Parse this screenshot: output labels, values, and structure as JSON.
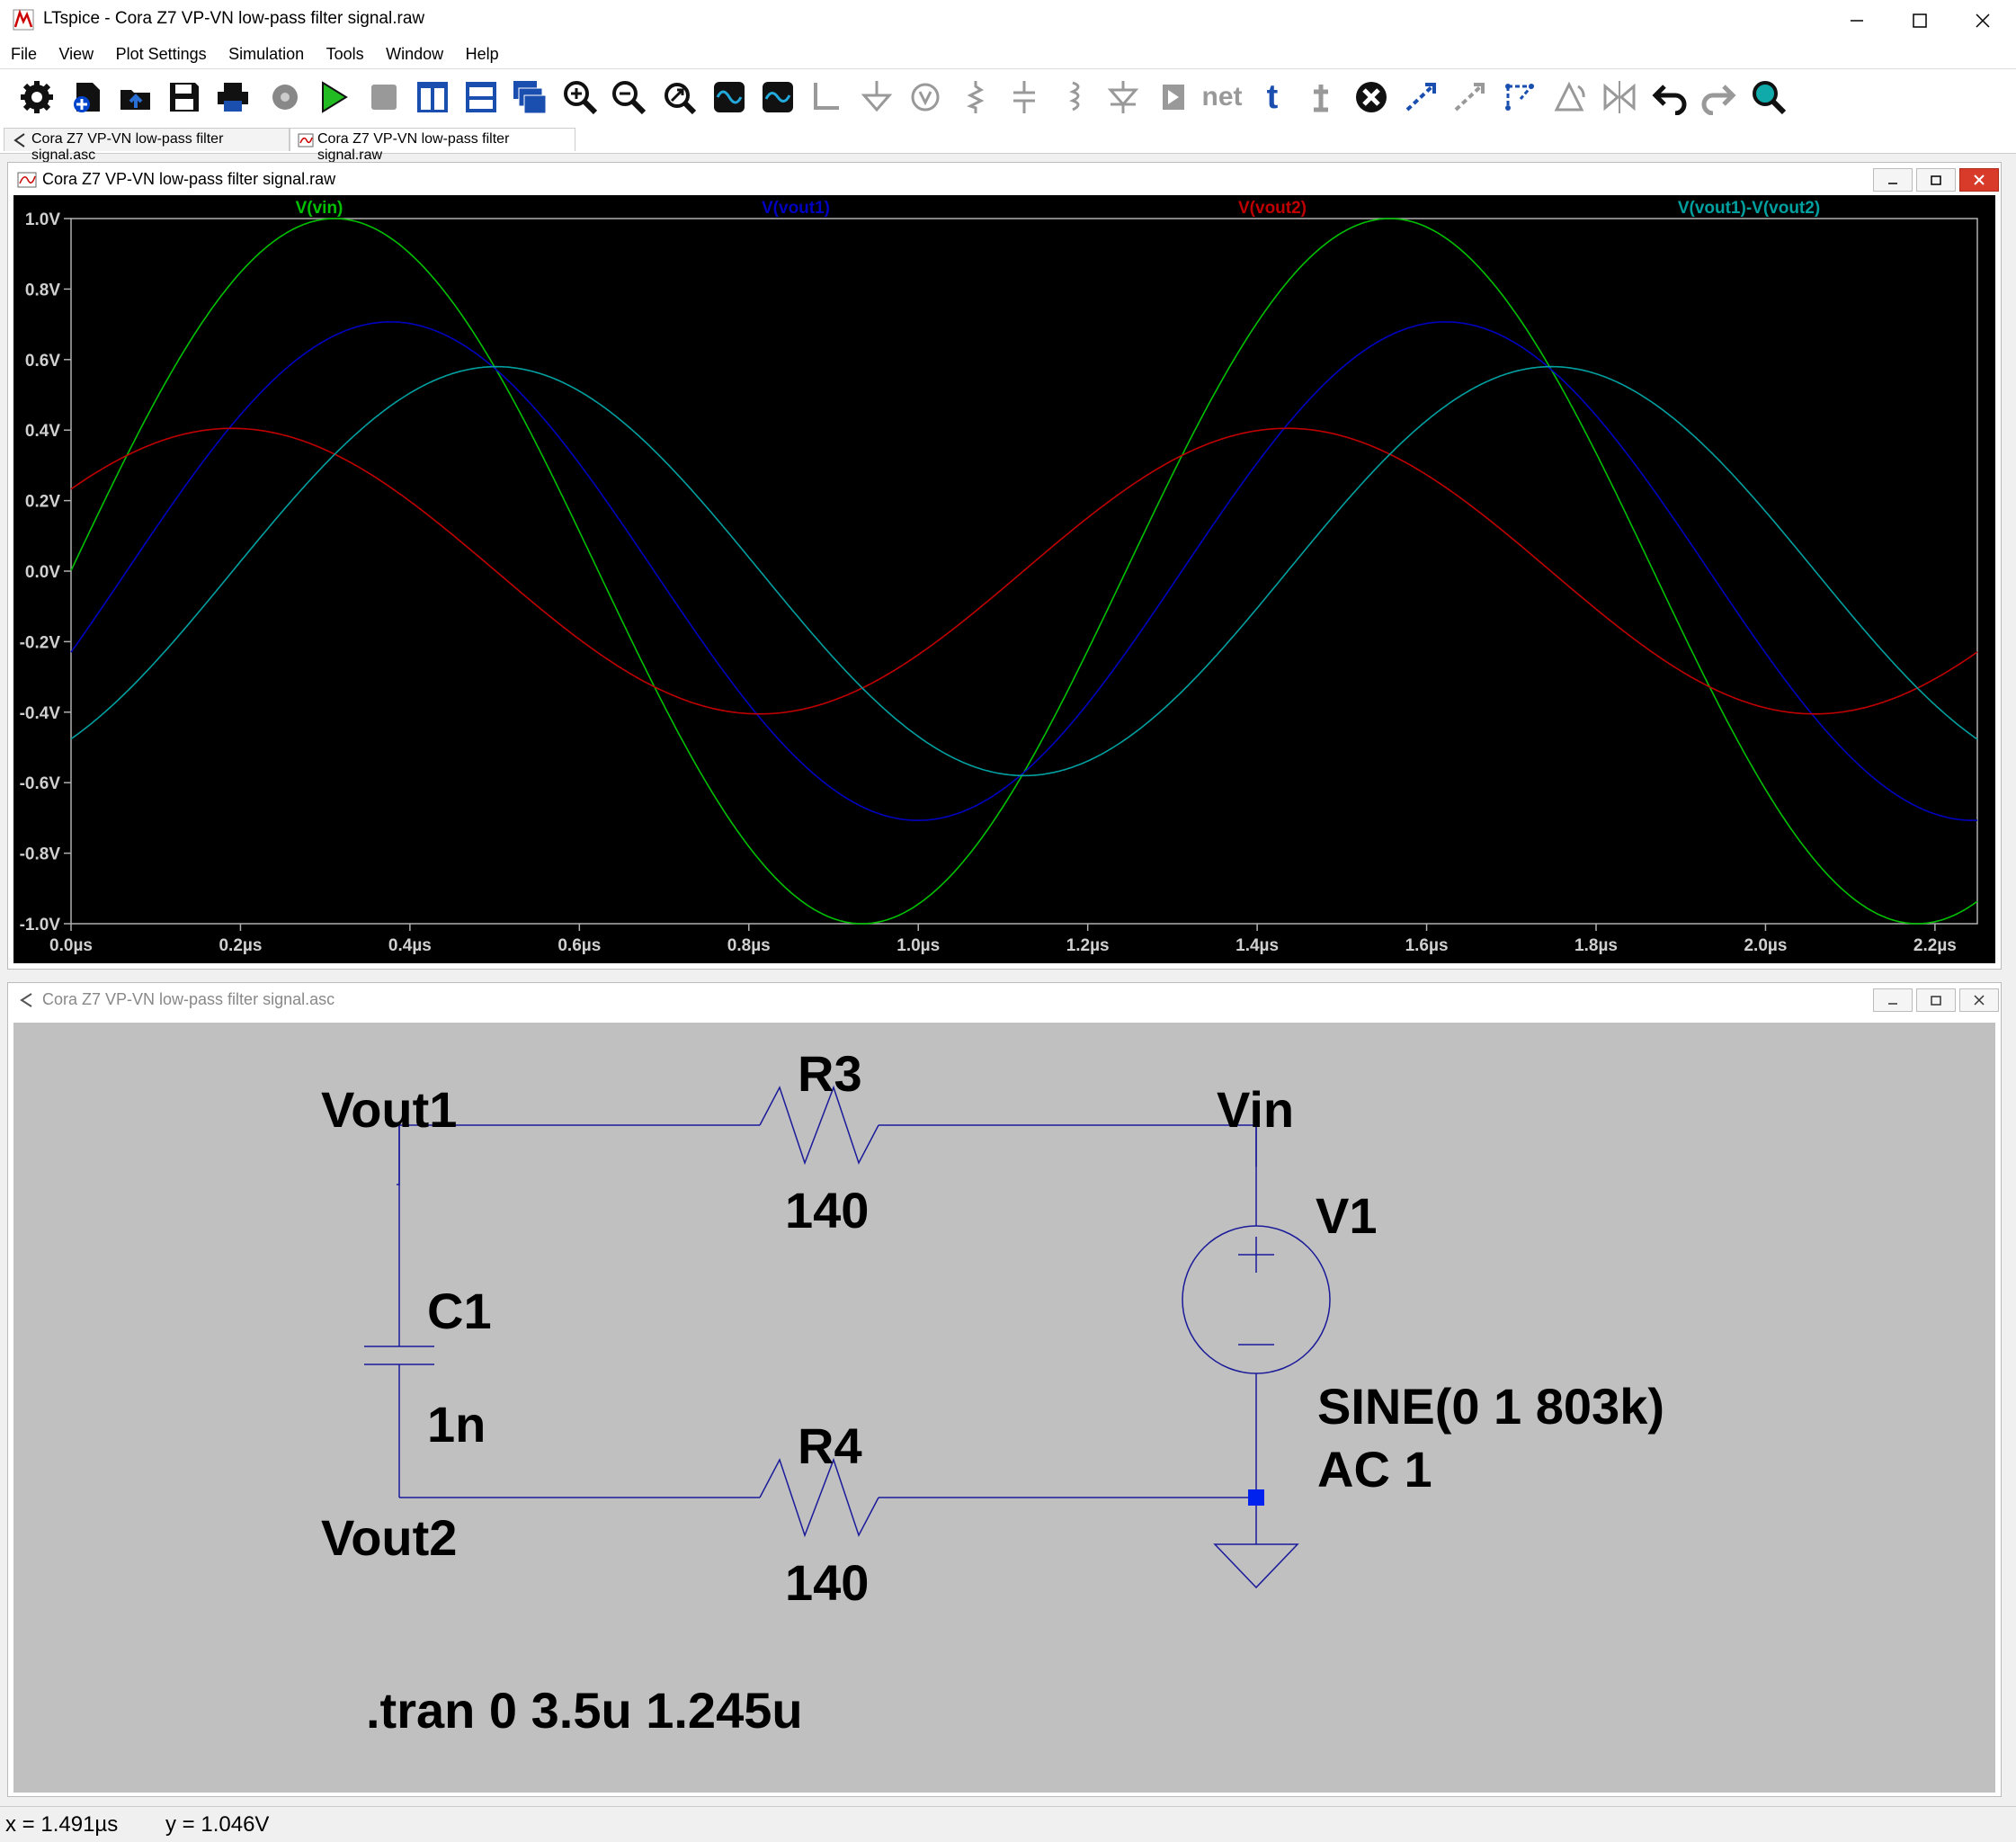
{
  "window": {
    "title": "LTspice - Cora Z7 VP-VN low-pass filter signal.raw",
    "controls": [
      "minimize",
      "maximize",
      "close"
    ]
  },
  "menu": [
    "File",
    "View",
    "Plot Settings",
    "Simulation",
    "Tools",
    "Window",
    "Help"
  ],
  "toolbar": {
    "icons": [
      "gear-icon",
      "new-schematic-icon",
      "open-icon",
      "save-icon",
      "print-icon",
      "settings-icon",
      "run-icon",
      "halt-icon",
      "tile-vertical-icon",
      "tile-horizontal-icon",
      "cascade-icon",
      "zoom-in-icon",
      "zoom-out-icon",
      "zoom-fit-icon",
      "autorange-icon",
      "waveform-icon",
      "wire-icon",
      "ground-icon",
      "label-net-icon",
      "resistor-icon",
      "capacitor-icon",
      "inductor-icon",
      "diode-icon",
      "component-icon",
      "net-label-icon",
      "text-icon",
      "spice-directive-icon",
      "delete-icon",
      "duplicate-icon",
      "move-icon",
      "drag-icon",
      "rotate-icon",
      "mirror-icon",
      "undo-icon",
      "redo-icon",
      "find-icon"
    ],
    "net_label": "net",
    "text_label": "t"
  },
  "tabs": [
    {
      "label": "Cora Z7 VP-VN low-pass filter signal.asc"
    },
    {
      "label": "Cora Z7 VP-VN low-pass filter signal.raw"
    }
  ],
  "plot_window": {
    "title": "Cora Z7 VP-VN low-pass filter signal.raw",
    "buttons": [
      "minimize",
      "restore",
      "close"
    ]
  },
  "chart_data": {
    "type": "line",
    "title": "",
    "xlabel": "",
    "ylabel": "",
    "xlim": [
      0,
      2.25
    ],
    "ylim": [
      -1.0,
      1.0
    ],
    "x_ticks": [
      "0.0µs",
      "0.2µs",
      "0.4µs",
      "0.6µs",
      "0.8µs",
      "1.0µs",
      "1.2µs",
      "1.4µs",
      "1.6µs",
      "1.8µs",
      "2.0µs",
      "2.2µs"
    ],
    "y_ticks": [
      "1.0V",
      "0.8V",
      "0.6V",
      "0.4V",
      "0.2V",
      "0.0V",
      "-0.2V",
      "-0.4V",
      "-0.6V",
      "-0.8V",
      "-1.0V"
    ],
    "grid": false,
    "background": "#000000",
    "legend_placement": "top",
    "series": [
      {
        "name": "V(vin)",
        "color": "#00c000",
        "amplitude": 1.0,
        "frequency_mhz": 0.803,
        "peak_at_us": 0.311,
        "peak_value": 1.0
      },
      {
        "name": "V(vout1)",
        "color": "#0000c0",
        "amplitude": 0.707,
        "frequency_mhz": 0.803,
        "peak_at_us": 0.377,
        "peak_value": 0.707
      },
      {
        "name": "V(vout2)",
        "color": "#c00000",
        "amplitude": 0.405,
        "frequency_mhz": 0.803,
        "peak_at_us": 0.19,
        "peak_value": 0.405
      },
      {
        "name": "V(vout1)-V(vout2)",
        "color": "#00a0a0",
        "amplitude": 0.58,
        "frequency_mhz": 0.803,
        "peak_at_us": 0.502,
        "peak_value": 0.58
      }
    ]
  },
  "schematic_window": {
    "title": "Cora Z7 VP-VN low-pass filter signal.asc",
    "buttons": [
      "minimize",
      "restore",
      "close"
    ]
  },
  "schematic": {
    "labels": {
      "vout1": "Vout1",
      "vout2": "Vout2",
      "vin": "Vin",
      "r3_name": "R3",
      "r3_value": "140",
      "r4_name": "R4",
      "r4_value": "140",
      "c1_name": "C1",
      "c1_value": "1n",
      "v1_name": "V1",
      "v1_value": "SINE(0 1 803k)",
      "v1_ac": "AC 1",
      "directive": ".tran 0 3.5u 1.245u"
    },
    "wire_color": "#0000a0",
    "symbol_color": "#000080"
  },
  "status": {
    "x": "x = 1.491µs",
    "y": "y = 1.046V"
  }
}
